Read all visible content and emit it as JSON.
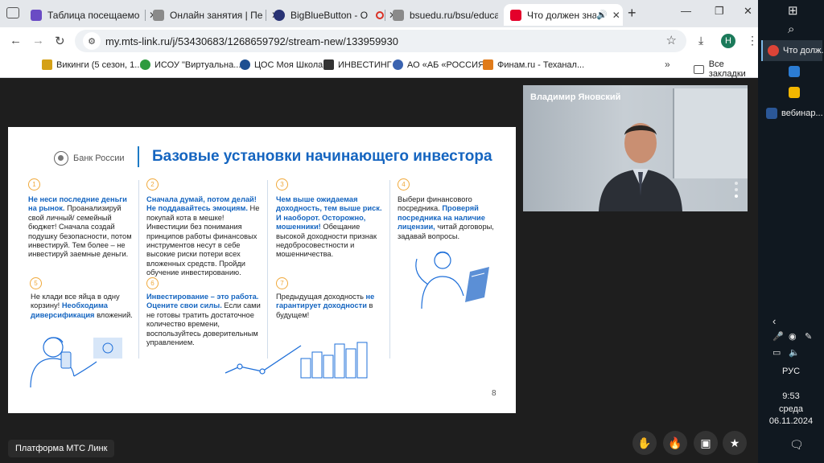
{
  "browser": {
    "tabs": [
      {
        "title": "Таблица посещаемо",
        "icon": "docs-icon",
        "color": "#6a4bc4"
      },
      {
        "title": "Онлайн занятия | Пе",
        "icon": "page-icon",
        "color": "#8a8a8a"
      },
      {
        "title": "BigBlueButton - О",
        "icon": "bbb-icon",
        "color": "#283274"
      },
      {
        "title": "bsuedu.ru/bsu/educat",
        "icon": "page-icon",
        "color": "#8a8a8a"
      },
      {
        "title": "Что должен знат",
        "icon": "mts-link-icon",
        "color": "#e4002b"
      }
    ],
    "url": "my.mts-link.ru/j/53430683/1268659792/stream-new/133959930",
    "profile_initial": "Н",
    "bookmarks": [
      {
        "label": "Викинги (5 сезон, 1...",
        "color": "#d4a017"
      },
      {
        "label": "ИСОУ \"Виртуальна...",
        "color": "#2e9b3f"
      },
      {
        "label": "ЦОС Моя Школа",
        "color": "#1d4f91"
      },
      {
        "label": "ИНВЕСТИНГ",
        "color": "#333333"
      },
      {
        "label": "АО «АБ «РОССИЯ»",
        "color": "#3a63b0"
      },
      {
        "label": "Финам.ru - Теханал...",
        "color": "#e07b1a"
      }
    ],
    "bookmarks_more": "»",
    "all_bookmarks": "Все закладки"
  },
  "slide": {
    "bank_name": "Банк России",
    "title": "Базовые установки начинающего инвестора",
    "page_number": "8",
    "items": [
      {
        "num": "1",
        "bold": "Не неси последние деньги на рынок.",
        "text": "Проанализируй свой личный/ семейный бюджет! Сначала создай подушку безопасности, потом инвестируй. Тем более – не инвестируй заемные деньги."
      },
      {
        "num": "2",
        "bold": "Сначала думай, потом делай! Не поддавайтесь эмоциям.",
        "text": "Не покупай кота в мешке! Инвестиции без понимания принципов работы финансовых инструментов несут в себе высокие риски потери всех вложенных средств. Пройди обучение инвестированию."
      },
      {
        "num": "3",
        "bold": "Чем выше ожидаемая доходность, тем выше риск. И наоборот. Осторожно, мошенники!",
        "text": "Обещание высокой доходности признак недобросовестности и мошенничества."
      },
      {
        "num": "4",
        "pre": "Выбери финансового посредника.",
        "bold": "Проверяй посредника на наличие лицензии,",
        "text": "читай договоры, задавай вопросы."
      },
      {
        "num": "5",
        "pre": "Не клади все яйца в одну корзину!",
        "bold": "Необходима диверсификация",
        "text": "вложений."
      },
      {
        "num": "6",
        "bold": "Инвестирование – это работа. Оцените свои силы.",
        "text": "Если сами не готовы тратить достаточное количество времени, воспользуйтесь доверительным управлением."
      },
      {
        "num": "7",
        "pre": "Предыдущая доходность",
        "bold": "не гарантирует доходности",
        "text": "в будущем!"
      }
    ]
  },
  "video": {
    "speaker_name": "Владимир Яновский"
  },
  "platform_label": "Платформа МТС Линк",
  "controls": [
    {
      "name": "raise-hand-button",
      "icon": "✋"
    },
    {
      "name": "reaction-button",
      "icon": "🔥"
    },
    {
      "name": "layout-button",
      "icon": "▣"
    },
    {
      "name": "favorite-button",
      "icon": "★"
    }
  ],
  "taskbar": {
    "apps": [
      {
        "label": "Что долж...",
        "color": "#dc4437"
      },
      {
        "label": "",
        "color": "#2b7cd3"
      },
      {
        "label": "",
        "color": "#f2b600"
      },
      {
        "label": "вебинар...",
        "color": "#2b5797"
      }
    ],
    "language": "РУС",
    "time": "9:53",
    "day": "среда",
    "date": "06.11.2024"
  }
}
